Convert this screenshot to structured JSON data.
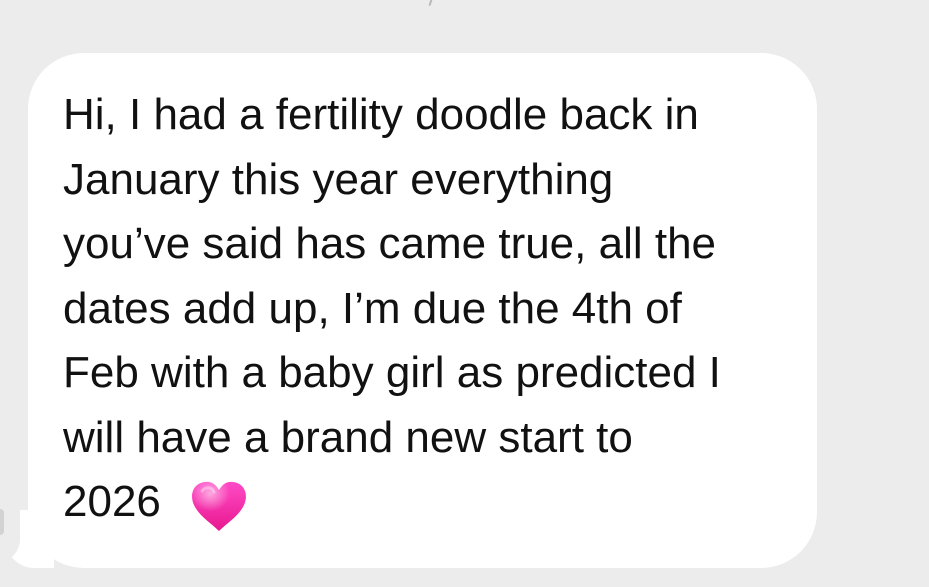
{
  "conversation": {
    "message": {
      "lines": [
        "Hi, I had a fertility doodle back in",
        "January this year everything",
        "you’ve said has came true, all the",
        "dates add up, I’m due the 4th of",
        "Feb with a baby girl as predicted I",
        "will have a brand new start to",
        "2026"
      ],
      "emoji": "pink-heart-icon"
    }
  },
  "colors": {
    "background": "#ececec",
    "bubble": "#ffffff",
    "text": "#111111",
    "heart_top": "#ff4bc7",
    "heart_bottom": "#e8188f"
  }
}
